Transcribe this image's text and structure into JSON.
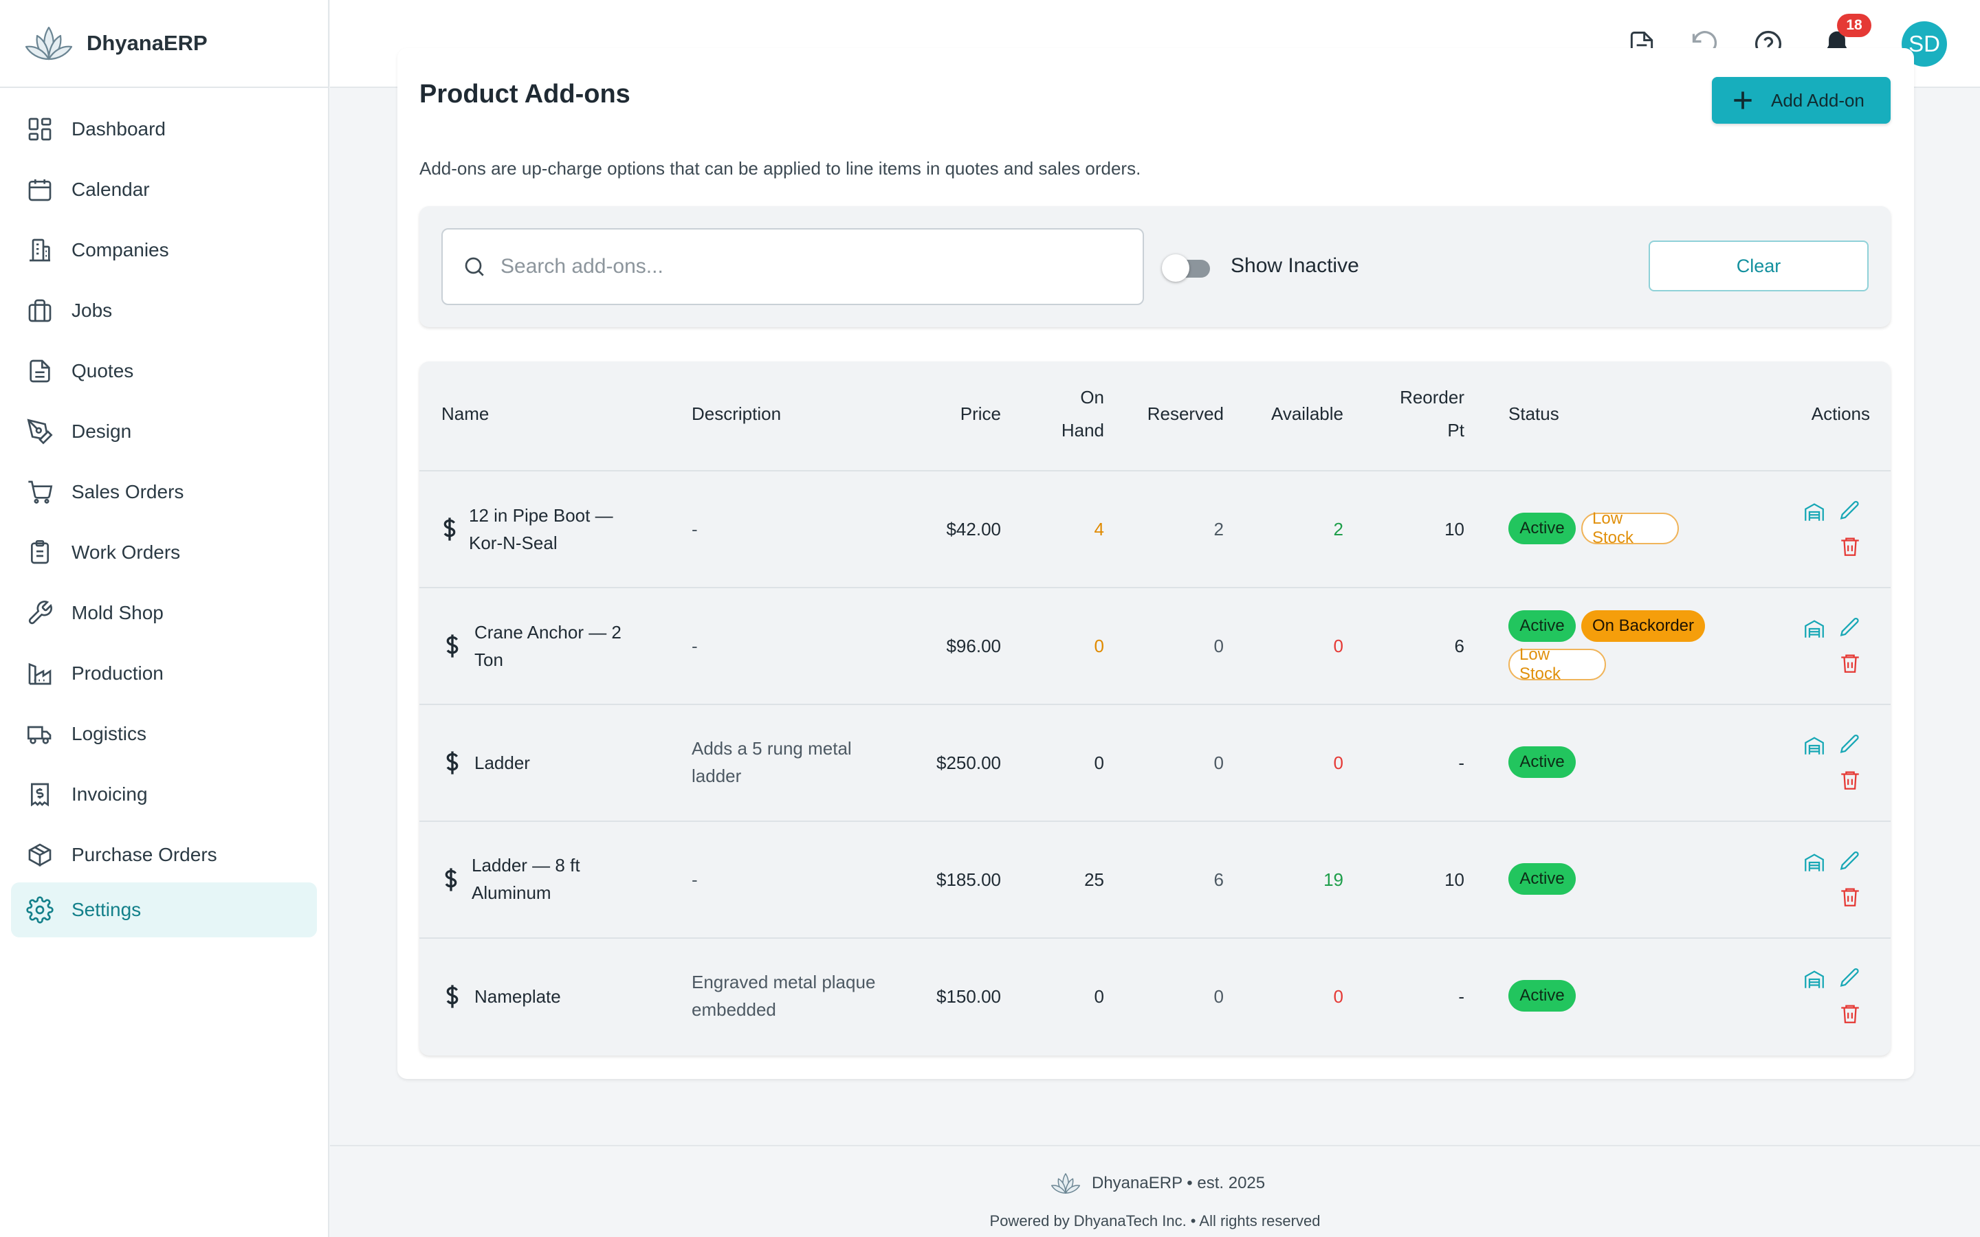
{
  "app": {
    "name": "DhyanaERP"
  },
  "sidebar": {
    "items": [
      {
        "label": "Dashboard",
        "icon": "dashboard-icon"
      },
      {
        "label": "Calendar",
        "icon": "calendar-icon"
      },
      {
        "label": "Companies",
        "icon": "building-icon"
      },
      {
        "label": "Jobs",
        "icon": "briefcase-icon"
      },
      {
        "label": "Quotes",
        "icon": "document-icon"
      },
      {
        "label": "Design",
        "icon": "pen-tool-icon"
      },
      {
        "label": "Sales Orders",
        "icon": "cart-icon"
      },
      {
        "label": "Work Orders",
        "icon": "clipboard-icon"
      },
      {
        "label": "Mold Shop",
        "icon": "wrench-icon"
      },
      {
        "label": "Production",
        "icon": "factory-icon"
      },
      {
        "label": "Logistics",
        "icon": "truck-icon"
      },
      {
        "label": "Invoicing",
        "icon": "invoice-icon"
      },
      {
        "label": "Purchase Orders",
        "icon": "package-icon"
      },
      {
        "label": "Settings",
        "icon": "gear-icon",
        "active": true
      }
    ]
  },
  "topbar": {
    "notifications": "18",
    "avatar_initials": "SD"
  },
  "page": {
    "title": "Product Add-ons",
    "add_button": "Add Add-on",
    "subtitle": "Add-ons are up-charge options that can be applied to line items in quotes and sales orders."
  },
  "filters": {
    "search_placeholder": "Search add-ons...",
    "show_inactive_label": "Show Inactive",
    "show_inactive": false,
    "clear_label": "Clear"
  },
  "table": {
    "headers": {
      "name": "Name",
      "description": "Description",
      "price": "Price",
      "on_hand_1": "On",
      "on_hand_2": "Hand",
      "reserved": "Reserved",
      "available": "Available",
      "reorder_1": "Reorder",
      "reorder_2": "Pt",
      "status": "Status",
      "actions": "Actions"
    },
    "rows": [
      {
        "name_1": "12 in Pipe Boot —",
        "name_2": "Kor-N-Seal",
        "desc_1": "-",
        "desc_2": "",
        "price": "$42.00",
        "on_hand": "4",
        "reserved": "2",
        "available": "2",
        "reorder": "10",
        "statuses": [
          "Active",
          "Low Stock"
        ]
      },
      {
        "name_1": "Crane Anchor — 2",
        "name_2": "Ton",
        "desc_1": "-",
        "desc_2": "",
        "price": "$96.00",
        "on_hand": "0",
        "reserved": "0",
        "available": "0",
        "reorder": "6",
        "statuses": [
          "Active",
          "On Backorder",
          "Low Stock"
        ]
      },
      {
        "name_1": "Ladder",
        "name_2": "",
        "desc_1": "Adds a 5 rung metal",
        "desc_2": "ladder",
        "price": "$250.00",
        "on_hand": "0",
        "reserved": "0",
        "available": "0",
        "reorder": "-",
        "statuses": [
          "Active"
        ]
      },
      {
        "name_1": "Ladder — 8 ft",
        "name_2": "Aluminum",
        "desc_1": "-",
        "desc_2": "",
        "price": "$185.00",
        "on_hand": "25",
        "reserved": "6",
        "available": "19",
        "reorder": "10",
        "statuses": [
          "Active"
        ]
      },
      {
        "name_1": "Nameplate",
        "name_2": "",
        "desc_1": "Engraved metal plaque",
        "desc_2": "embedded",
        "price": "$150.00",
        "on_hand": "0",
        "reserved": "0",
        "available": "0",
        "reorder": "-",
        "statuses": [
          "Active"
        ]
      }
    ]
  },
  "footer": {
    "line1": "DhyanaERP • est. 2025",
    "line2": "Powered by DhyanaTech Inc. • All rights reserved"
  },
  "colors": {
    "accent": "#17aebd",
    "active_green": "#22c55e",
    "warning_orange": "#f59e0b",
    "danger_red": "#e53935"
  }
}
